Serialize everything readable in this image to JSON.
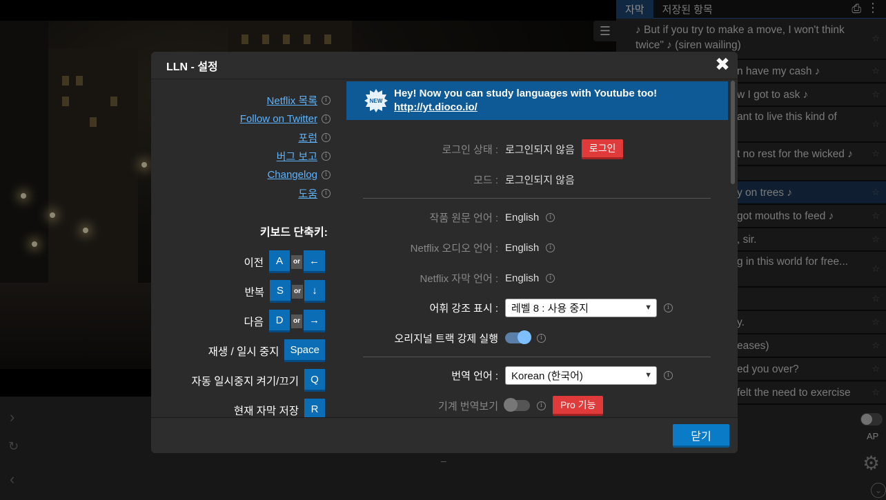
{
  "right_panel": {
    "tabs": [
      "자막",
      "저장된 항목"
    ],
    "subtitles": [
      {
        "text": "♪ But if you try to make a move, I won't think twice\" ♪ (siren wailing)",
        "highlight": false
      },
      {
        "text": "n have my cash ♪",
        "highlight": false
      },
      {
        "text": "w I got to ask ♪",
        "highlight": false
      },
      {
        "text": "ant to live this kind of",
        "highlight": false
      },
      {
        "text": "t no rest for the wicked ♪",
        "highlight": false
      },
      {
        "text": "",
        "highlight": false
      },
      {
        "text": "y on trees ♪",
        "highlight": true
      },
      {
        "text": "got mouths to feed ♪",
        "highlight": false
      },
      {
        "text": ", sir.",
        "highlight": false
      },
      {
        "text": "g in this world for free...",
        "highlight": false
      },
      {
        "text": "",
        "highlight": false
      },
      {
        "text": "y.",
        "highlight": false
      },
      {
        "text": "eases)",
        "highlight": false
      },
      {
        "text": "ed you over?",
        "highlight": false
      },
      {
        "text": "felt the need to exercise",
        "highlight": false
      }
    ],
    "ap_label": "AP"
  },
  "modal": {
    "title": "LLN - 설정",
    "close_label": "닫기",
    "links": [
      "Netflix 목록",
      "Follow on Twitter",
      "포럼",
      "버그 보고",
      "Changelog",
      "도움"
    ],
    "keyboard_title": "키보드 단축키:",
    "or_label": "or",
    "shortcuts": [
      {
        "label": "이전",
        "key": "A",
        "arrow": "←"
      },
      {
        "label": "반복",
        "key": "S",
        "arrow": "↓"
      },
      {
        "label": "다음",
        "key": "D",
        "arrow": "→"
      },
      {
        "label": "재생 / 일시 중지",
        "key": "Space"
      },
      {
        "label": "자동 일시중지 켜기/끄기",
        "key": "Q"
      },
      {
        "label": "현재 자막 저장",
        "key": "R"
      }
    ],
    "banner": {
      "badge": "NEW",
      "text": "Hey! Now you can study languages with Youtube too!",
      "link": "http://yt.dioco.io/"
    },
    "login_label": "로그인 상태 :",
    "login_value": "로그인되지 않음",
    "login_button": "로그인",
    "mode_label": "모드 :",
    "mode_value": "로그인되지 않음",
    "original_lang_label": "작품 원문 언어 :",
    "original_lang_value": "English",
    "audio_lang_label": "Netflix 오디오 언어 :",
    "audio_lang_value": "English",
    "subtitle_lang_label": "Netflix 자막 언어 :",
    "subtitle_lang_value": "English",
    "vocab_label": "어휘 강조 표시 :",
    "vocab_value": "레벨 8 : 사용 중지",
    "original_track_label": "오리지널 트랙 강제 실행",
    "translation_label": "번역 언어 :",
    "translation_value": "Korean (한국어)",
    "machine_label": "기계 번역보기",
    "pro_label": "Pro 기능"
  }
}
